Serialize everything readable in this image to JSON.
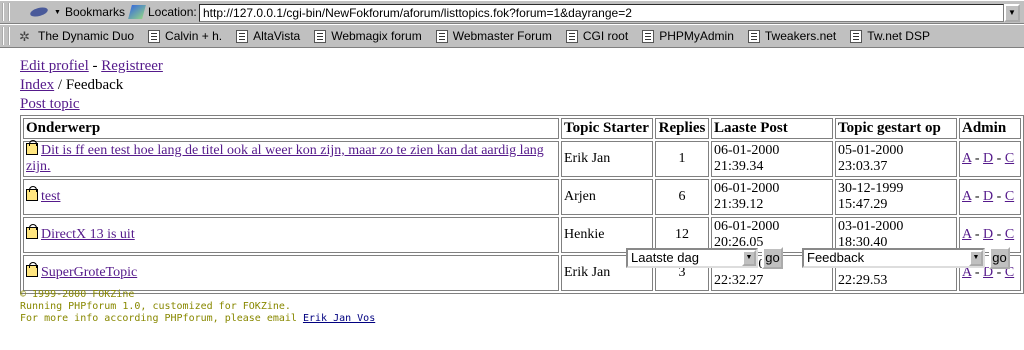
{
  "browser": {
    "bookmarks_label": "Bookmarks",
    "location_label": "Location:",
    "url": "http://127.0.0.1/cgi-bin/NewFokforum/aforum/listtopics.fok?forum=1&dayrange=2",
    "personal_links": [
      "The Dynamic Duo",
      "Calvin + h.",
      "AltaVista",
      "Webmagix forum",
      "Webmaster Forum",
      "CGI root",
      "PHPMyAdmin",
      "Tweakers.net",
      "Tw.net DSP"
    ]
  },
  "nav": {
    "edit_profile": "Edit profiel",
    "dash": " - ",
    "register": "Registreer",
    "index": "Index",
    "slash": " / ",
    "current": "Feedback",
    "post_topic": "Post topic"
  },
  "table": {
    "headers": [
      "Onderwerp",
      "Topic Starter",
      "Replies",
      "Laaste Post",
      "Topic gestart op",
      "Admin"
    ],
    "rows": [
      {
        "subject": "Dit is ff een test hoe lang de titel ook al weer kon zijn, maar zo te zien kan dat aardig lang zijn.",
        "starter": "Erik Jan",
        "replies": "1",
        "last_post": "06-01-2000 21:39.34",
        "started": "05-01-2000 23:03.37"
      },
      {
        "subject": "test",
        "starter": "Arjen",
        "replies": "6",
        "last_post": "06-01-2000 21:39.12",
        "started": "30-12-1999 15:47.29"
      },
      {
        "subject": "DirectX 13 is uit",
        "starter": "Henkie",
        "replies": "12",
        "last_post": "06-01-2000 20:26.05",
        "started": "03-01-2000 18:30.40"
      },
      {
        "subject": "SuperGroteTopic",
        "starter": "Erik Jan",
        "replies": "3",
        "last_post": "05-01-2000 22:32.27",
        "started": "05-01-2000 22:29.53"
      }
    ],
    "admin": {
      "a": "A",
      "d": "D",
      "c": "C",
      "sep": " - "
    }
  },
  "controls": {
    "dayrange_value": "Laatste dag",
    "go_label": "go",
    "forum_value": "Feedback"
  },
  "footer": {
    "copyright": "© 1999-2000 FOKZine",
    "running": "Running PHPforum 1.0, customized for FOKZine.",
    "more_info": "For more info according PHPforum, please email ",
    "email_name": "Erik Jan Vos"
  }
}
